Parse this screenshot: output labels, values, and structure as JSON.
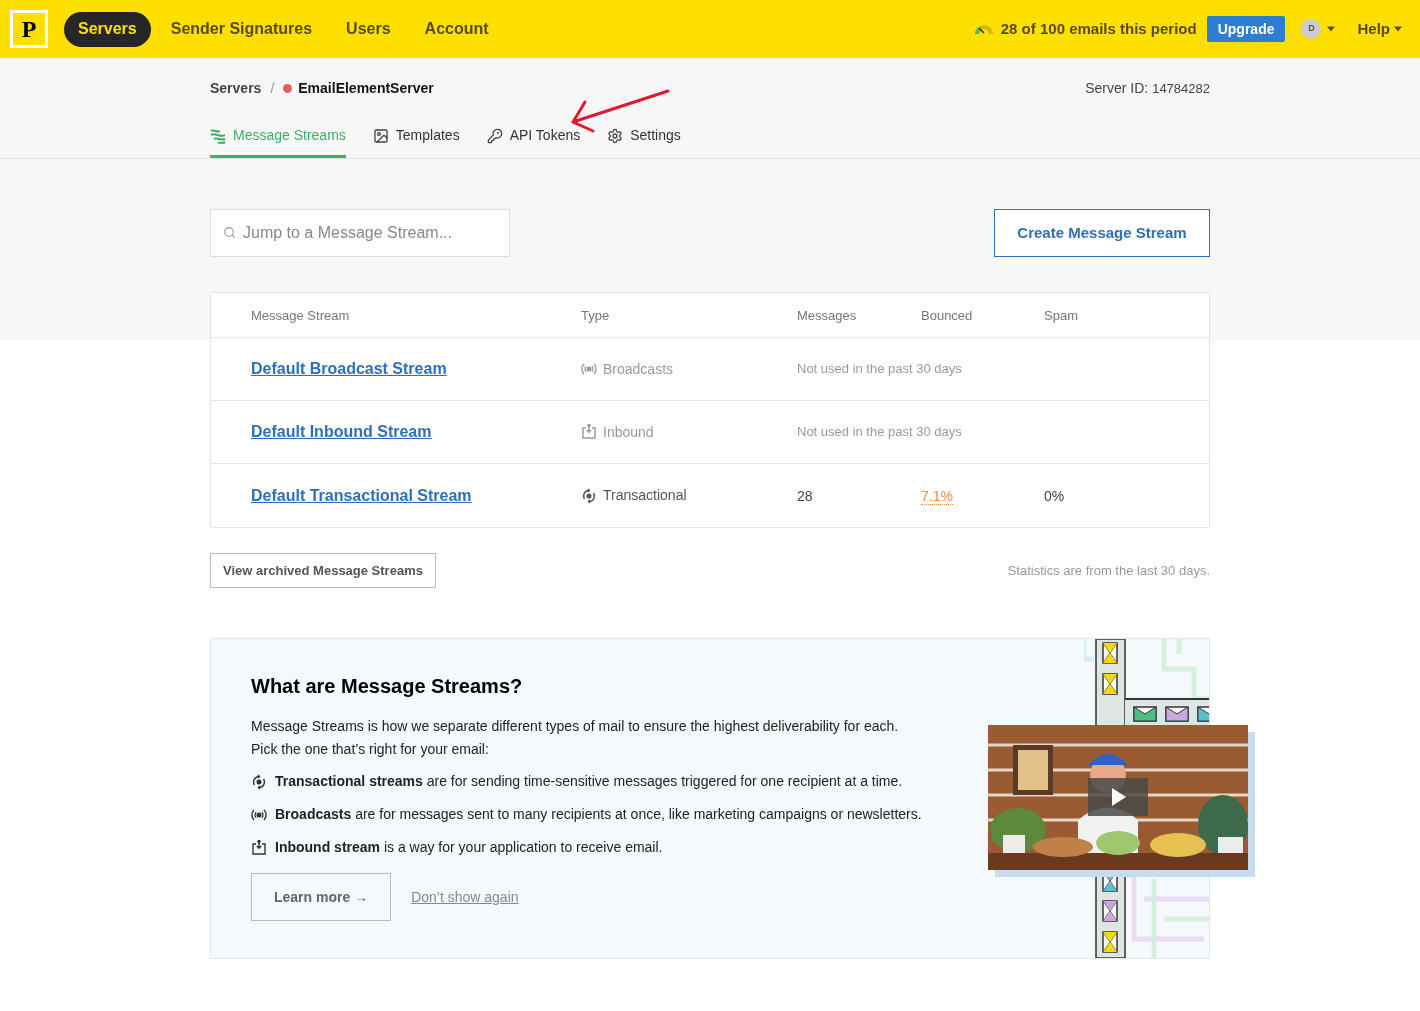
{
  "nav": {
    "logo": "P",
    "items": [
      {
        "label": "Servers",
        "selected": true
      },
      {
        "label": "Sender Signatures",
        "selected": false
      },
      {
        "label": "Users",
        "selected": false
      },
      {
        "label": "Account",
        "selected": false
      }
    ],
    "usage": "28 of 100 emails this period",
    "upgrade": "Upgrade",
    "avatar": "D",
    "help": "Help"
  },
  "breadcrumb": {
    "root": "Servers",
    "separator": "/",
    "server": "EmailElementServer",
    "color": "#e85d5d"
  },
  "server_id": {
    "label": "Server ID:",
    "value": "14784282"
  },
  "tabs": [
    {
      "label": "Message Streams",
      "kind": "streams",
      "selected": true
    },
    {
      "label": "Templates",
      "kind": "templates",
      "selected": false
    },
    {
      "label": "API Tokens",
      "kind": "key",
      "selected": false
    },
    {
      "label": "Settings",
      "kind": "gear",
      "selected": false
    }
  ],
  "search": {
    "placeholder": "Jump to a Message Stream..."
  },
  "create_button": "Create Message Stream",
  "table": {
    "columns": [
      "Message Stream",
      "Type",
      "Messages",
      "Bounced",
      "Spam"
    ],
    "rows": [
      {
        "name": "Default Broadcast Stream",
        "type": {
          "kind": "broadcast",
          "label": "Broadcasts"
        },
        "messages": "Not used in the past 30 days"
      },
      {
        "name": "Default Inbound Stream",
        "type": {
          "kind": "inbound",
          "label": "Inbound"
        },
        "messages": "Not used in the past 30 days"
      },
      {
        "name": "Default Transactional Stream",
        "type": {
          "kind": "transactional",
          "label": "Transactional"
        },
        "messages": "28",
        "bounced": "7.1%",
        "spam": "0%"
      }
    ]
  },
  "archived_button": "View archived Message Streams",
  "stats_note": "Statistics are from the last 30 days.",
  "info": {
    "title": "What are Message Streams?",
    "intro": [
      "Message Streams is how we separate different types of mail to ensure the highest deliverability for each.",
      "Pick the one that’s right for your email:"
    ],
    "bullets": [
      {
        "kind": "transactional",
        "text": "**Transactional streams** are for sending time-sensitive messages triggered for one recipient at a time."
      },
      {
        "kind": "broadcast",
        "text": "**Broadcasts** are for messages sent to many recipients at once, like marketing campaigns or newsletters."
      },
      {
        "kind": "inbound",
        "text": "**Inbound stream** is a way for your application to receive email."
      }
    ],
    "learn_more": "Learn more →",
    "dont_show": "Don’t show again",
    "video": {
      "kind": "picture"
    }
  }
}
